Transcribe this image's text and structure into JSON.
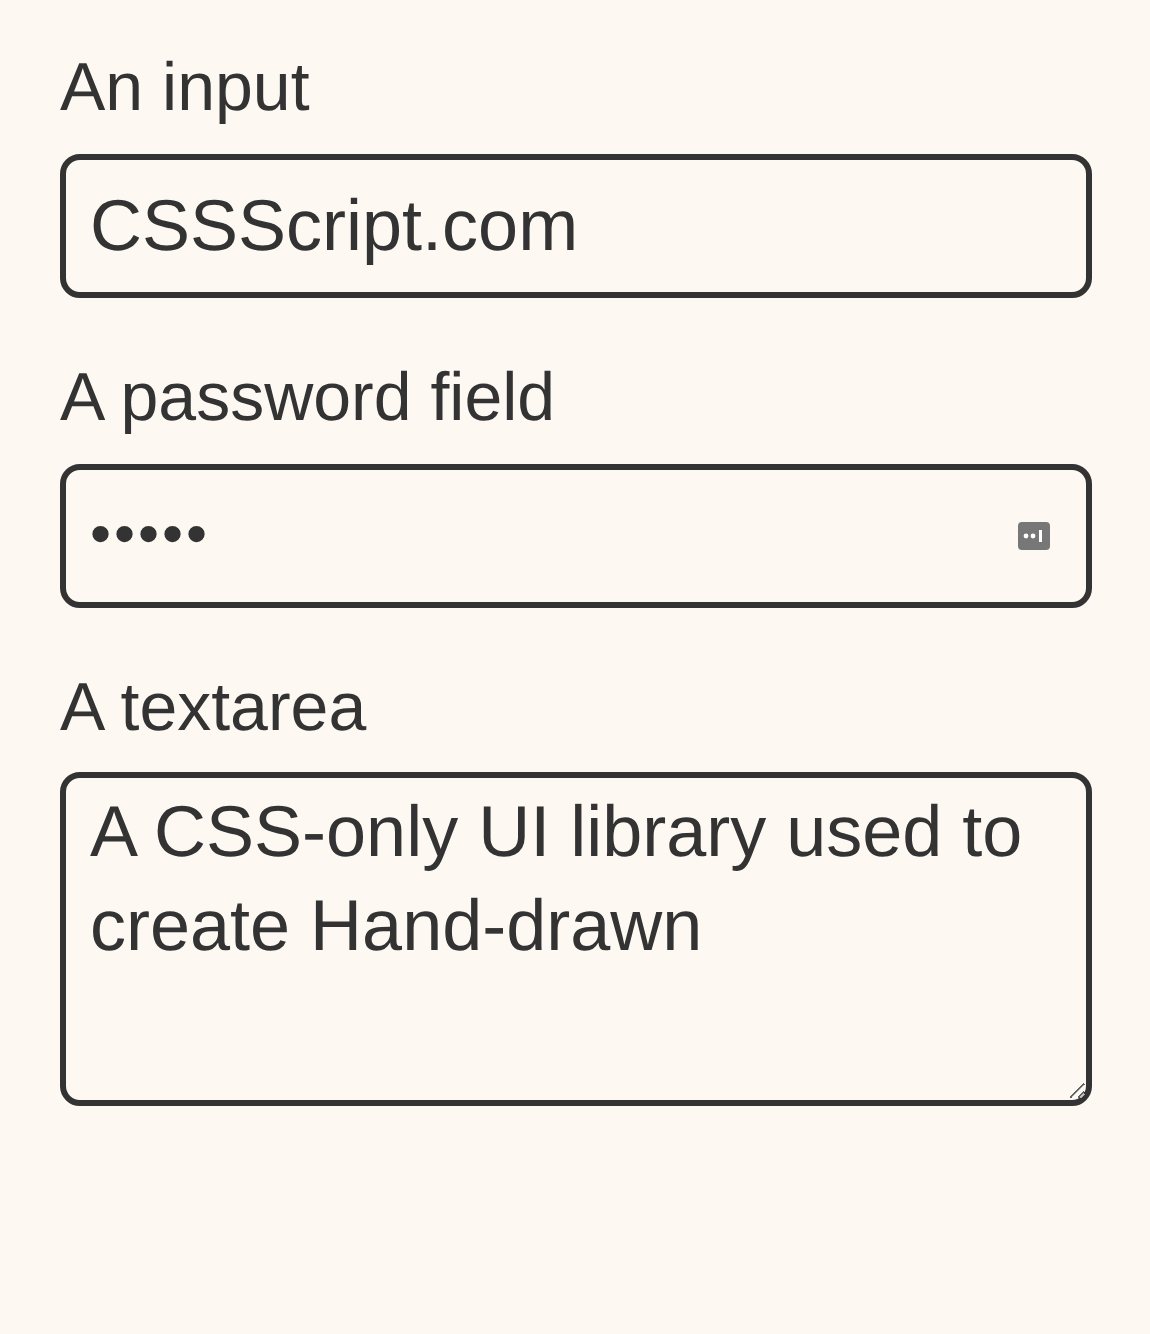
{
  "fields": [
    {
      "kind": "text",
      "label": "An input",
      "value": "CSSScript.com"
    },
    {
      "kind": "password",
      "label": "A password field",
      "value": "•••••"
    },
    {
      "kind": "textarea",
      "label": "A textarea",
      "value": "A CSS-only UI library used to create Hand-drawn"
    }
  ]
}
